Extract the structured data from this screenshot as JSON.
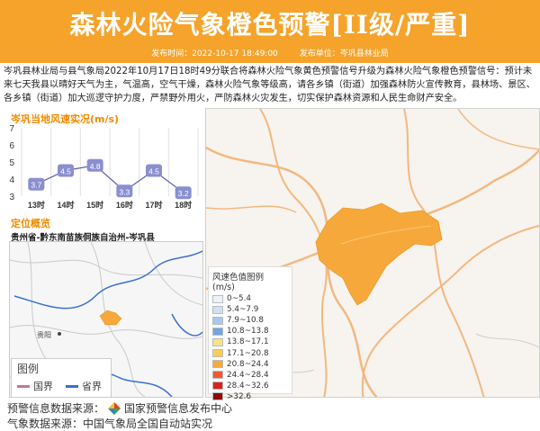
{
  "header": {
    "title": "森林火险气象橙色预警[II级/严重]",
    "publish_time": "发布时间：2022-10-17 18:49:00",
    "publisher": "发布单位：岑巩县林业局"
  },
  "description": "岑巩县林业局与县气象局2022年10月17日18时49分联合将森林火险气象黄色预警信号升级为森林火险气象橙色预警信号：预计未来七天我县以晴好天气为主，气温高，空气干燥，森林火险气象等级高，请各乡镇（街道）加强森林防火宣传教育，县林场、景区、各乡镇（街道）加大巡逻守护力度，严禁野外用火，严防森林火灾发生，切实保护森林资源和人民生命财产安全。",
  "wind_panel": {
    "title": "岑巩当地风速实况(m/s)"
  },
  "chart_data": {
    "type": "line",
    "title": "岑巩当地风速实况(m/s)",
    "categories": [
      "13时",
      "14时",
      "15时",
      "16时",
      "17时",
      "18时"
    ],
    "values": [
      3.7,
      4.5,
      4.8,
      3.3,
      4.5,
      3.2
    ],
    "ylim": [
      3,
      7
    ],
    "yticks": [
      3,
      4,
      5,
      6,
      7
    ],
    "grid": true,
    "label_color": "#8a8fd0",
    "line_color": "#5a5fa8"
  },
  "location_panel": {
    "title": "定位概览",
    "subtitle": "贵州省-黔东南苗族侗族自治州-岑巩县",
    "city_label": "贵阳",
    "legend_title": "图例",
    "legend_country": "国界",
    "legend_province": "省界"
  },
  "wind_legend": {
    "title": "风速色值图例 (m/s)",
    "items": [
      {
        "label": "0~5.4",
        "color": "#eef3fb"
      },
      {
        "label": "5.4~7.9",
        "color": "#cfe0f5"
      },
      {
        "label": "7.9~10.8",
        "color": "#a7c8ee"
      },
      {
        "label": "10.8~13.8",
        "color": "#6fa5e4"
      },
      {
        "label": "13.8~17.1",
        "color": "#f7e28a"
      },
      {
        "label": "17.1~20.8",
        "color": "#f9cc52"
      },
      {
        "label": "20.8~24.4",
        "color": "#f6a93a"
      },
      {
        "label": "24.4~28.4",
        "color": "#ef5a2f"
      },
      {
        "label": "28.4~32.6",
        "color": "#d8231f"
      },
      {
        "label": ">32.6",
        "color": "#8b0b0b"
      }
    ]
  },
  "footer": {
    "source_label": "预警信息数据来源：",
    "source_name": "国家预警信息发布中心",
    "source2": "气象数据来源：中国气象局全国自动站实况"
  },
  "colors": {
    "header_bg": "#f5a32a",
    "accent_orange": "#f08a00",
    "county_fill": "#f6a93a"
  }
}
